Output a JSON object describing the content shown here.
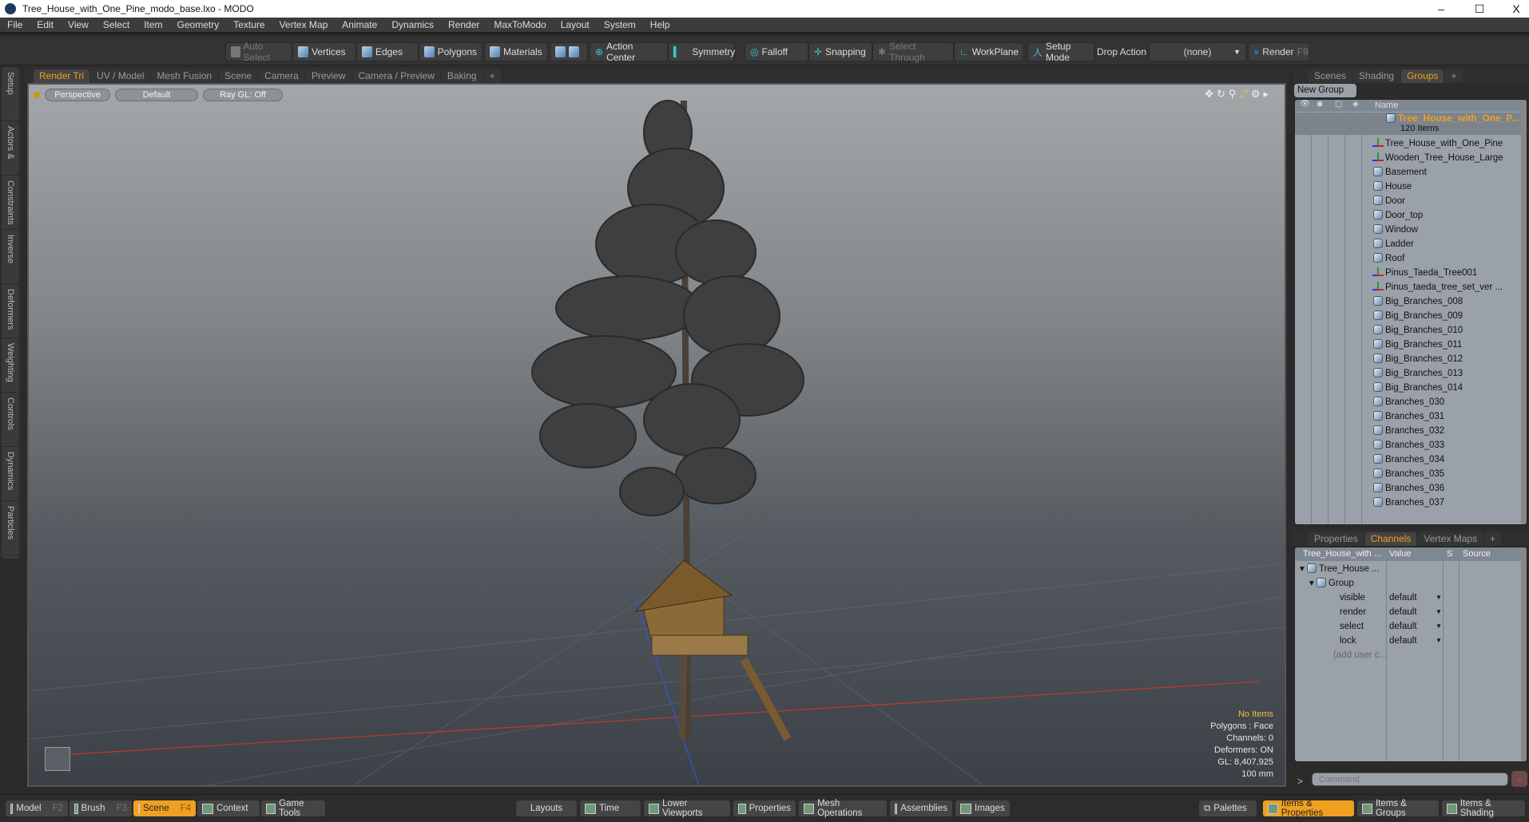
{
  "window": {
    "title": "Tree_House_with_One_Pine_modo_base.lxo - MODO",
    "minimize": "–",
    "maximize": "☐",
    "close": "X"
  },
  "menu": [
    "File",
    "Edit",
    "View",
    "Select",
    "Item",
    "Geometry",
    "Texture",
    "Vertex Map",
    "Animate",
    "Dynamics",
    "Render",
    "MaxToModo",
    "Layout",
    "System",
    "Help"
  ],
  "toolbar": {
    "auto_select": "Auto Select",
    "vertices": "Vertices",
    "edges": "Edges",
    "polygons": "Polygons",
    "materials": "Materials",
    "action_center": "Action Center",
    "symmetry": "Symmetry",
    "falloff": "Falloff",
    "snapping": "Snapping",
    "select_through": "Select Through",
    "workplane": "WorkPlane",
    "setup_mode": "Setup Mode",
    "drop_action_label": "Drop Action",
    "drop_action_value": "(none)",
    "render": "Render",
    "render_key": "F9"
  },
  "viewport_tabs": [
    "Render Tri",
    "UV / Model",
    "Mesh Fusion",
    "Scene",
    "Camera",
    "Preview",
    "Camera / Preview",
    "Baking",
    "+"
  ],
  "viewport_tabs_active": "Render Tri",
  "left_tabs": [
    "Setup",
    "Actors & Sets",
    "Constraints",
    "Inverse Kinematics",
    "Deformers",
    "Weighting",
    "Controls",
    "Dynamics",
    "Particles"
  ],
  "viewport": {
    "view": "Perspective",
    "shading": "Default",
    "raygl": "Ray GL: Off",
    "info": {
      "selection": "No Items",
      "polygons": "Polygons : Face",
      "channels": "Channels: 0",
      "deformers": "Deformers: ON",
      "gl": "GL: 8,407,925",
      "scale": "100 mm"
    }
  },
  "right_tabs": [
    "Scenes",
    "Shading",
    "Groups",
    "+"
  ],
  "groups": {
    "new_group": "New Group",
    "name_header": "Name",
    "root": {
      "name": "Tree_House_with_One_P...",
      "count": "120 Items"
    },
    "items": [
      {
        "name": "Tree_House_with_One_Pine",
        "icon": "locator"
      },
      {
        "name": "Wooden_Tree_House_Large",
        "icon": "locator"
      },
      {
        "name": "Basement",
        "icon": "mesh"
      },
      {
        "name": "House",
        "icon": "mesh"
      },
      {
        "name": "Door",
        "icon": "mesh"
      },
      {
        "name": "Door_top",
        "icon": "mesh"
      },
      {
        "name": "Window",
        "icon": "mesh"
      },
      {
        "name": "Ladder",
        "icon": "mesh"
      },
      {
        "name": "Roof",
        "icon": "mesh"
      },
      {
        "name": "Pinus_Taeda_Tree001",
        "icon": "locator"
      },
      {
        "name": "Pinus_taeda_tree_set_ver ...",
        "icon": "locator"
      },
      {
        "name": "Big_Branches_008",
        "icon": "mesh"
      },
      {
        "name": "Big_Branches_009",
        "icon": "mesh"
      },
      {
        "name": "Big_Branches_010",
        "icon": "mesh"
      },
      {
        "name": "Big_Branches_011",
        "icon": "mesh"
      },
      {
        "name": "Big_Branches_012",
        "icon": "mesh"
      },
      {
        "name": "Big_Branches_013",
        "icon": "mesh"
      },
      {
        "name": "Big_Branches_014",
        "icon": "mesh"
      },
      {
        "name": "Branches_030",
        "icon": "mesh"
      },
      {
        "name": "Branches_031",
        "icon": "mesh"
      },
      {
        "name": "Branches_032",
        "icon": "mesh"
      },
      {
        "name": "Branches_033",
        "icon": "mesh"
      },
      {
        "name": "Branches_034",
        "icon": "mesh"
      },
      {
        "name": "Branches_035",
        "icon": "mesh"
      },
      {
        "name": "Branches_036",
        "icon": "mesh"
      },
      {
        "name": "Branches_037",
        "icon": "mesh"
      }
    ]
  },
  "channel_tabs": [
    "Properties",
    "Channels",
    "Vertex Maps",
    "+"
  ],
  "channels": {
    "headers": [
      "Tree_House_with ...",
      "Value",
      "S",
      "Source"
    ],
    "item": "Tree_House ...",
    "group": "Group",
    "rows": [
      {
        "name": "visible",
        "value": "default"
      },
      {
        "name": "render",
        "value": "default"
      },
      {
        "name": "select",
        "value": "default"
      },
      {
        "name": "lock",
        "value": "default"
      }
    ],
    "add": "(add user c..."
  },
  "command": {
    "prompt": ">",
    "placeholder": "Command"
  },
  "bottom": {
    "left": [
      {
        "label": "Model",
        "key": "F2"
      },
      {
        "label": "Brush",
        "key": "F3"
      },
      {
        "label": "Scene",
        "key": "F4",
        "active": true
      },
      {
        "label": "Context"
      },
      {
        "label": "Game Tools"
      }
    ],
    "mid": [
      "Layouts",
      "Time",
      "Lower Viewports",
      "Properties",
      "Mesh Operations",
      "Assemblies",
      "Images"
    ],
    "palettes": "Palettes",
    "right": [
      "Items & Properties",
      "Items & Groups",
      "Items & Shading"
    ]
  },
  "colors": {
    "accent": "#f0a020",
    "panel": "#9aa1a8"
  }
}
